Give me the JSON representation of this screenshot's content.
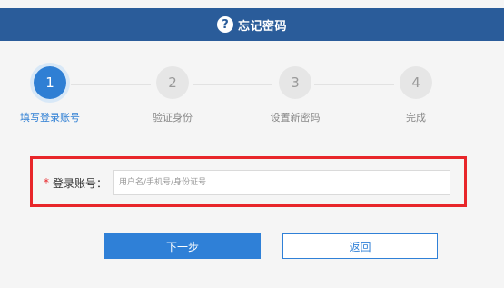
{
  "header": {
    "icon": "question-circle-icon",
    "icon_glyph": "?",
    "title": "忘记密码",
    "color": "#2a5c9a"
  },
  "steps": [
    {
      "number": "1",
      "label": "填写登录账号",
      "active": true
    },
    {
      "number": "2",
      "label": "验证身份",
      "active": false
    },
    {
      "number": "3",
      "label": "设置新密码",
      "active": false
    },
    {
      "number": "4",
      "label": "完成",
      "active": false
    }
  ],
  "form": {
    "required_mark": "*",
    "account_label": "登录账号：",
    "account_value": "",
    "account_placeholder": "用户名/手机号/身份证号"
  },
  "buttons": {
    "next_label": "下一步",
    "back_label": "返回"
  },
  "colors": {
    "accent": "#2f80d7",
    "highlight": "#e8262a"
  }
}
